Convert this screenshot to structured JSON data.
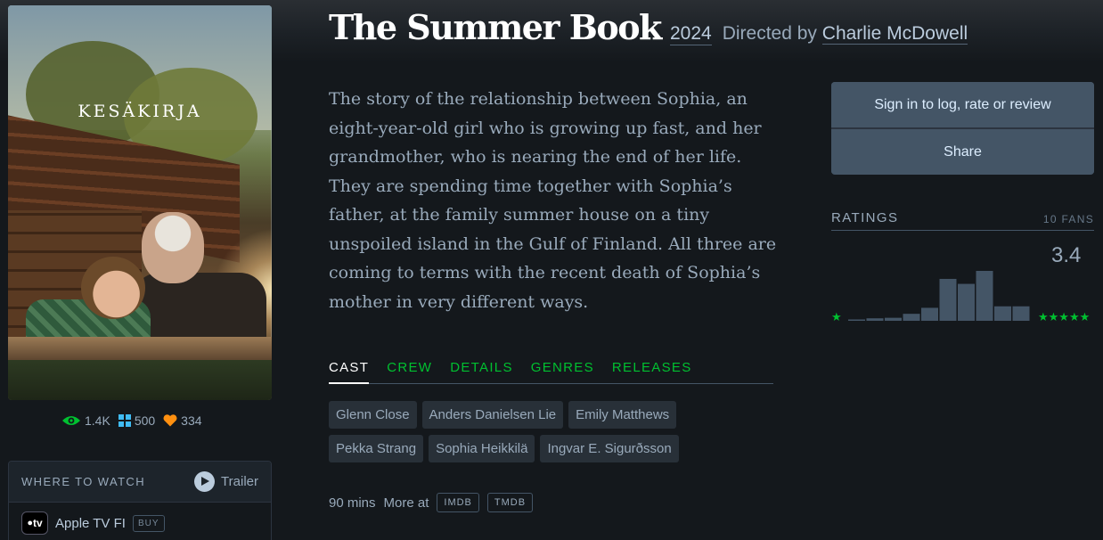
{
  "film": {
    "title": "The Summer Book",
    "year": "2024",
    "directed_by": "Directed by",
    "director": "Charlie McDowell",
    "synopsis": "The story of the relationship between Sophia, an eight-year-old girl who is growing up fast, and her grandmother, who is nearing the end of her life. They are spending time together with Sophia’s father, at the family summer house on a tiny unspoiled island in the Gulf of Finland. All three are coming to terms with the recent death of Sophia’s mother in very different ways.",
    "poster_title": "KESÄKIRJA"
  },
  "stats": {
    "watched": "1.4K",
    "lists": "500",
    "likes": "334"
  },
  "where_to_watch": {
    "label": "WHERE TO WATCH",
    "trailer": "Trailer",
    "service_logo": "tv",
    "service": "Apple TV FI",
    "buy": "BUY"
  },
  "tabs": [
    "CAST",
    "CREW",
    "DETAILS",
    "GENRES",
    "RELEASES"
  ],
  "cast": [
    "Glenn Close",
    "Anders Danielsen Lie",
    "Emily Matthews",
    "Pekka Strang",
    "Sophia Heikkilä",
    "Ingvar E. Sigurðsson"
  ],
  "footer": {
    "runtime": "90 mins",
    "more_at": "More at",
    "imdb": "IMDB",
    "tmdb": "TMDB"
  },
  "actions": {
    "sign_in": "Sign in to log, rate or review",
    "share": "Share"
  },
  "ratings": {
    "label": "RATINGS",
    "fans": "10 FANS",
    "average": "3.4",
    "min_label": "★",
    "max_label": "★★★★★",
    "histogram": [
      0.02,
      0.05,
      0.06,
      0.14,
      0.26,
      0.84,
      0.74,
      1.0,
      0.29,
      0.29
    ]
  },
  "colors": {
    "green": "#00c030",
    "orange": "#ff9010",
    "blue": "#40bcf4",
    "bar": "#445566"
  }
}
